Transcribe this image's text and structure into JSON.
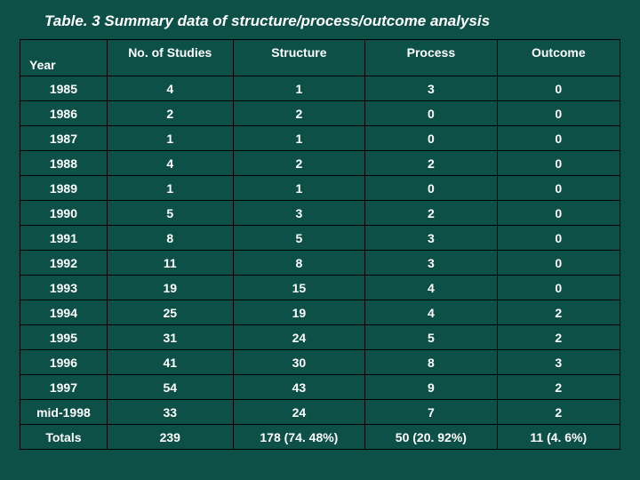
{
  "title": "Table. 3 Summary data of structure/process/outcome analysis",
  "headers": {
    "year": "Year",
    "studies": "No. of Studies",
    "structure": "Structure",
    "process": "Process",
    "outcome": "Outcome"
  },
  "rows": [
    {
      "year": "1985",
      "studies": "4",
      "structure": "1",
      "process": "3",
      "outcome": "0"
    },
    {
      "year": "1986",
      "studies": "2",
      "structure": "2",
      "process": "0",
      "outcome": "0"
    },
    {
      "year": "1987",
      "studies": "1",
      "structure": "1",
      "process": "0",
      "outcome": "0"
    },
    {
      "year": "1988",
      "studies": "4",
      "structure": "2",
      "process": "2",
      "outcome": "0"
    },
    {
      "year": "1989",
      "studies": "1",
      "structure": "1",
      "process": "0",
      "outcome": "0"
    },
    {
      "year": "1990",
      "studies": "5",
      "structure": "3",
      "process": "2",
      "outcome": "0"
    },
    {
      "year": "1991",
      "studies": "8",
      "structure": "5",
      "process": "3",
      "outcome": "0"
    },
    {
      "year": "1992",
      "studies": "11",
      "structure": "8",
      "process": "3",
      "outcome": "0"
    },
    {
      "year": "1993",
      "studies": "19",
      "structure": "15",
      "process": "4",
      "outcome": "0"
    },
    {
      "year": "1994",
      "studies": "25",
      "structure": "19",
      "process": "4",
      "outcome": "2"
    },
    {
      "year": "1995",
      "studies": "31",
      "structure": "24",
      "process": "5",
      "outcome": "2"
    },
    {
      "year": "1996",
      "studies": "41",
      "structure": "30",
      "process": "8",
      "outcome": "3"
    },
    {
      "year": "1997",
      "studies": "54",
      "structure": "43",
      "process": "9",
      "outcome": "2"
    },
    {
      "year": "mid-1998",
      "studies": "33",
      "structure": "24",
      "process": "7",
      "outcome": "2"
    }
  ],
  "totals": {
    "label": "Totals",
    "studies": "239",
    "structure": "178 (74. 48%)",
    "process": "50 (20. 92%)",
    "outcome": "11 (4. 6%)"
  },
  "chart_data": {
    "type": "table",
    "title": "Summary data of structure/process/outcome analysis",
    "columns": [
      "Year",
      "No. of Studies",
      "Structure",
      "Process",
      "Outcome"
    ],
    "rows": [
      [
        "1985",
        4,
        1,
        3,
        0
      ],
      [
        "1986",
        2,
        2,
        0,
        0
      ],
      [
        "1987",
        1,
        1,
        0,
        0
      ],
      [
        "1988",
        4,
        2,
        2,
        0
      ],
      [
        "1989",
        1,
        1,
        0,
        0
      ],
      [
        "1990",
        5,
        3,
        2,
        0
      ],
      [
        "1991",
        8,
        5,
        3,
        0
      ],
      [
        "1992",
        11,
        8,
        3,
        0
      ],
      [
        "1993",
        19,
        15,
        4,
        0
      ],
      [
        "1994",
        25,
        19,
        4,
        2
      ],
      [
        "1995",
        31,
        24,
        5,
        2
      ],
      [
        "1996",
        41,
        30,
        8,
        3
      ],
      [
        "1997",
        54,
        43,
        9,
        2
      ],
      [
        "mid-1998",
        33,
        24,
        7,
        2
      ]
    ],
    "totals": [
      "Totals",
      239,
      "178 (74.48%)",
      "50 (20.92%)",
      "11 (4.6%)"
    ]
  }
}
